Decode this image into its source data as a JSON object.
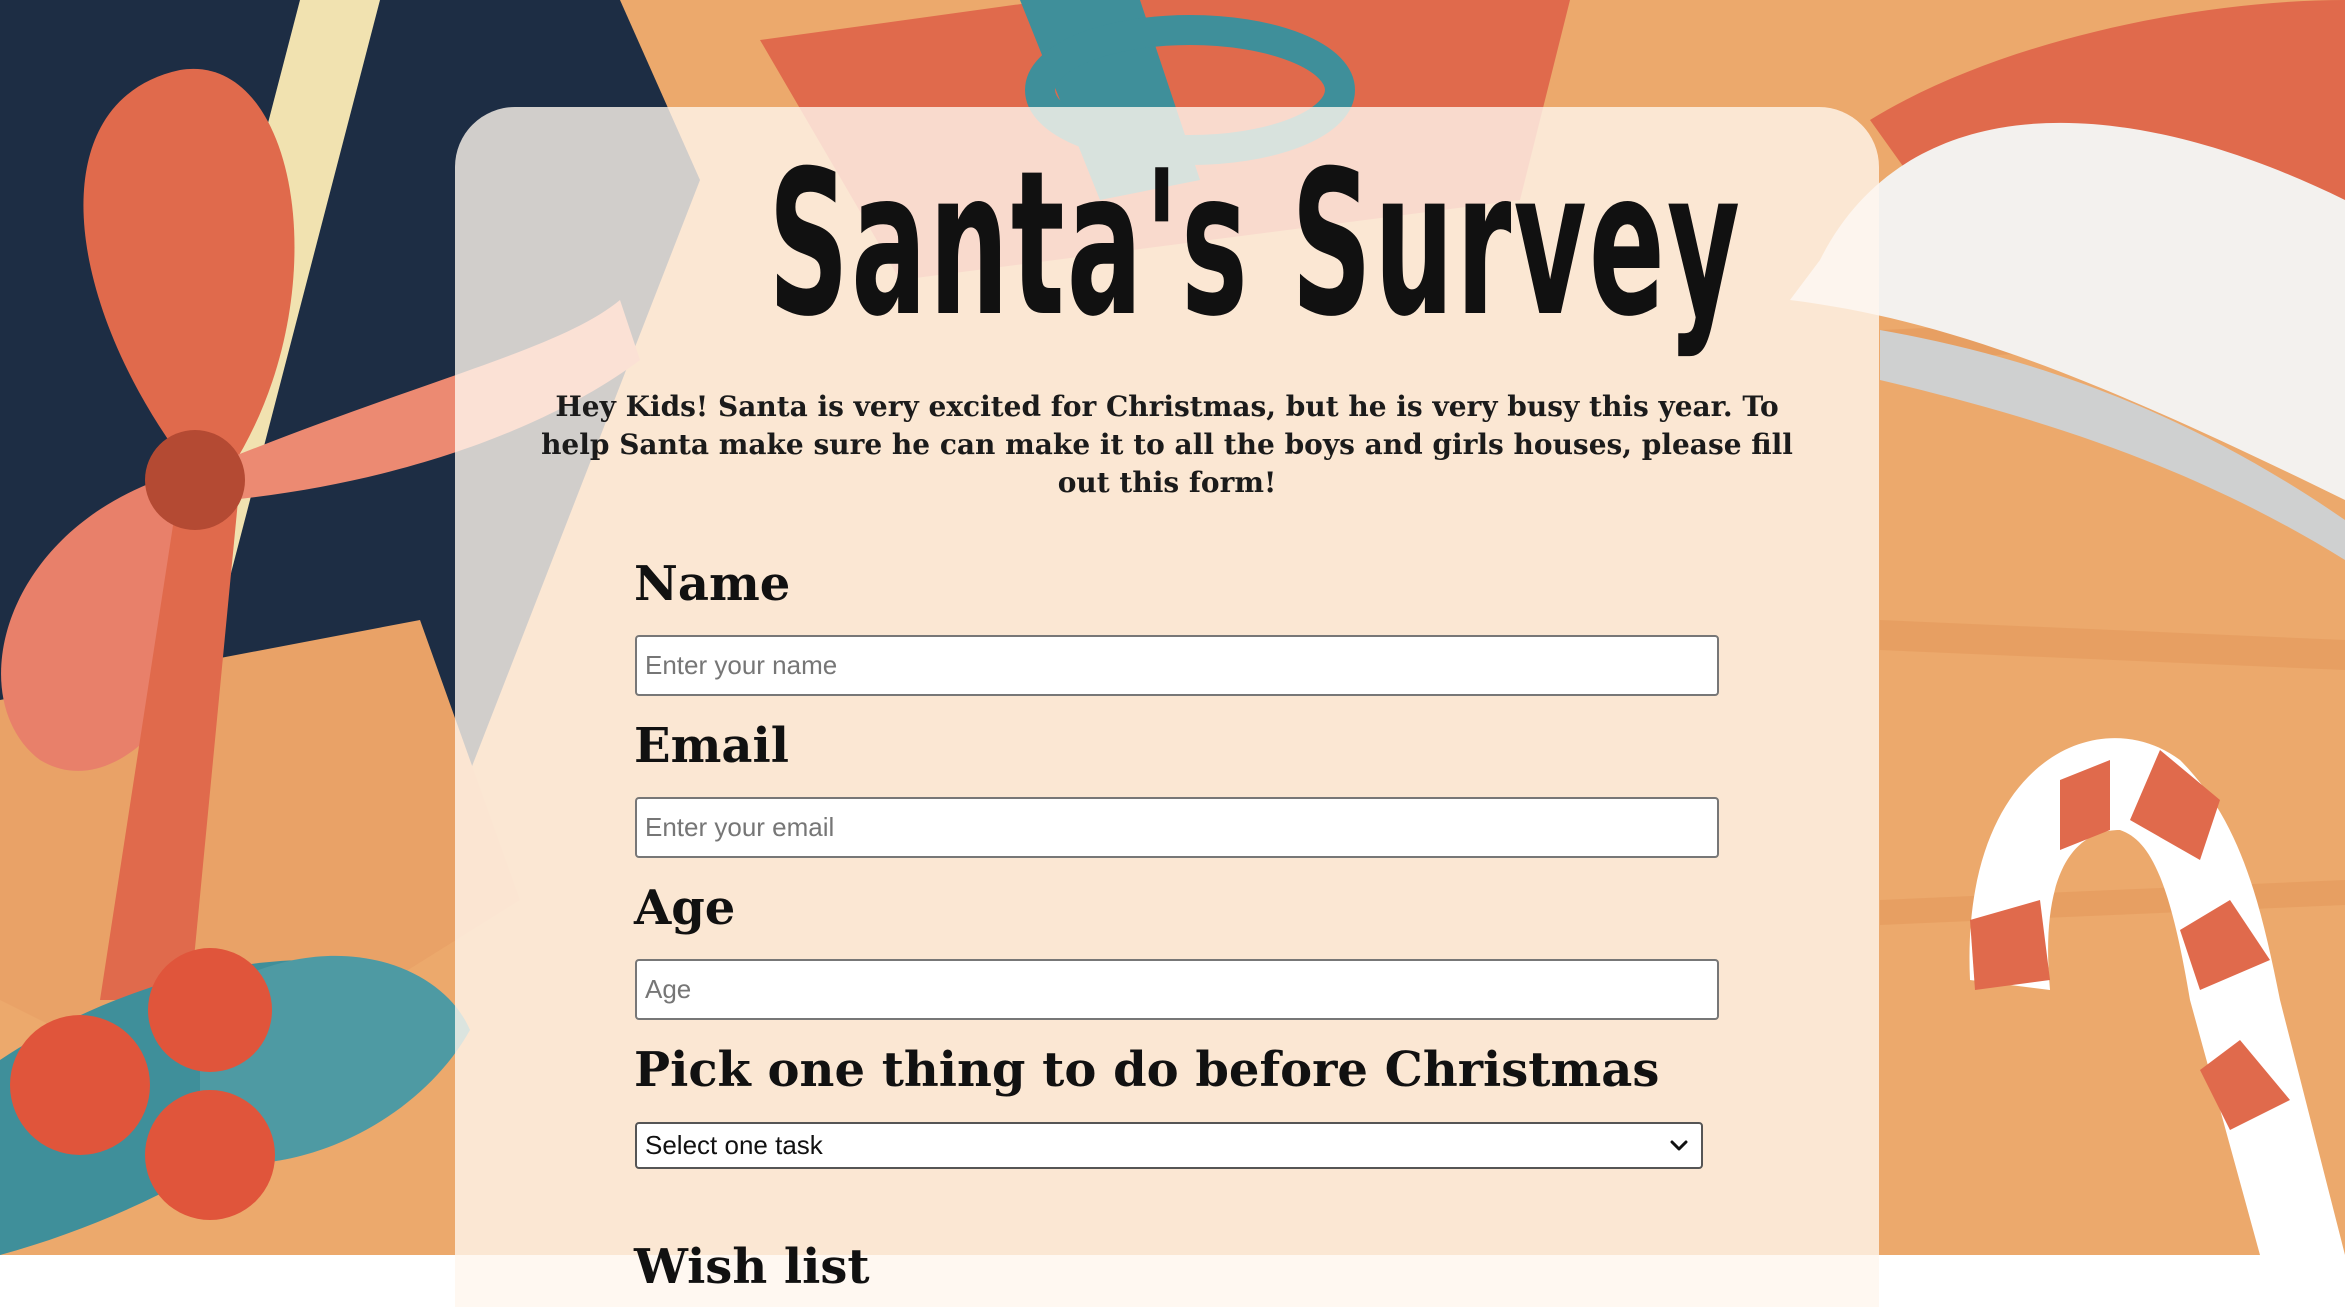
{
  "page": {
    "title": "Santa's Survey",
    "intro": "Hey Kids! Santa is very excited for Christmas, but he is very busy this year. To help Santa make sure he can make it to all the boys and girls houses, please fill out this form!"
  },
  "form": {
    "name": {
      "label": "Name",
      "placeholder": "Enter your name",
      "value": ""
    },
    "email": {
      "label": "Email",
      "placeholder": "Enter your email",
      "value": ""
    },
    "age": {
      "label": "Age",
      "placeholder": "Age",
      "value": ""
    },
    "task": {
      "label": "Pick one thing to do before Christmas",
      "selected": "Select one task"
    },
    "wishlist": {
      "label": "Wish list"
    }
  },
  "theme": {
    "background": "#eca96c",
    "card": "#fff6ee",
    "navy": "#1d2d44",
    "red": "#e06a4c",
    "teal": "#3f8f9a"
  },
  "icons": [
    "chevron-down-icon"
  ]
}
